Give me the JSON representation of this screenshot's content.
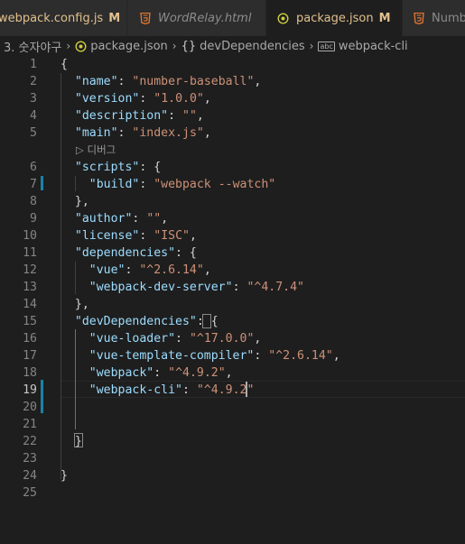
{
  "tabs": [
    {
      "label": "webpack.config.js",
      "status": "M",
      "has_close": true,
      "icon": "none",
      "italic": false
    },
    {
      "label": "WordRelay.html",
      "icon": "html5-icon",
      "italic": true
    },
    {
      "label": "package.json",
      "status": "M",
      "icon": "json-icon",
      "active": true,
      "unsaved_dot": true
    },
    {
      "label": "Numbe",
      "icon": "html5-icon",
      "italic": false
    }
  ],
  "breadcrumb": {
    "folder": "3. 숫자야구",
    "file": "package.json",
    "section": "devDependencies",
    "leaf": "webpack-cli",
    "braces": "{}",
    "abc": "abc"
  },
  "codelens": "디버그",
  "code_lines": [
    {
      "n": "1",
      "tokens": [
        {
          "t": "p",
          "v": "{"
        }
      ]
    },
    {
      "n": "2",
      "tokens": [
        {
          "t": "p",
          "v": "  "
        },
        {
          "t": "k",
          "v": "\"name\""
        },
        {
          "t": "p",
          "v": ": "
        },
        {
          "t": "s",
          "v": "\"number-baseball\""
        },
        {
          "t": "p",
          "v": ","
        }
      ]
    },
    {
      "n": "3",
      "tokens": [
        {
          "t": "p",
          "v": "  "
        },
        {
          "t": "k",
          "v": "\"version\""
        },
        {
          "t": "p",
          "v": ": "
        },
        {
          "t": "s",
          "v": "\"1.0.0\""
        },
        {
          "t": "p",
          "v": ","
        }
      ]
    },
    {
      "n": "4",
      "tokens": [
        {
          "t": "p",
          "v": "  "
        },
        {
          "t": "k",
          "v": "\"description\""
        },
        {
          "t": "p",
          "v": ": "
        },
        {
          "t": "s",
          "v": "\"\""
        },
        {
          "t": "p",
          "v": ","
        }
      ]
    },
    {
      "n": "5",
      "tokens": [
        {
          "t": "p",
          "v": "  "
        },
        {
          "t": "k",
          "v": "\"main\""
        },
        {
          "t": "p",
          "v": ": "
        },
        {
          "t": "s",
          "v": "\"index.js\""
        },
        {
          "t": "p",
          "v": ","
        }
      ]
    },
    {
      "n": "6",
      "tokens": [
        {
          "t": "p",
          "v": "  "
        },
        {
          "t": "k",
          "v": "\"scripts\""
        },
        {
          "t": "p",
          "v": ": {"
        }
      ]
    },
    {
      "n": "7",
      "tokens": [
        {
          "t": "p",
          "v": "    "
        },
        {
          "t": "k",
          "v": "\"build\""
        },
        {
          "t": "p",
          "v": ": "
        },
        {
          "t": "s",
          "v": "\"webpack --watch\""
        }
      ]
    },
    {
      "n": "8",
      "tokens": [
        {
          "t": "p",
          "v": "  },"
        }
      ]
    },
    {
      "n": "9",
      "tokens": [
        {
          "t": "p",
          "v": "  "
        },
        {
          "t": "k",
          "v": "\"author\""
        },
        {
          "t": "p",
          "v": ": "
        },
        {
          "t": "s",
          "v": "\"\""
        },
        {
          "t": "p",
          "v": ","
        }
      ]
    },
    {
      "n": "10",
      "tokens": [
        {
          "t": "p",
          "v": "  "
        },
        {
          "t": "k",
          "v": "\"license\""
        },
        {
          "t": "p",
          "v": ": "
        },
        {
          "t": "s",
          "v": "\"ISC\""
        },
        {
          "t": "p",
          "v": ","
        }
      ]
    },
    {
      "n": "11",
      "tokens": [
        {
          "t": "p",
          "v": "  "
        },
        {
          "t": "k",
          "v": "\"dependencies\""
        },
        {
          "t": "p",
          "v": ": {"
        }
      ]
    },
    {
      "n": "12",
      "tokens": [
        {
          "t": "p",
          "v": "    "
        },
        {
          "t": "k",
          "v": "\"vue\""
        },
        {
          "t": "p",
          "v": ": "
        },
        {
          "t": "s",
          "v": "\"^2.6.14\""
        },
        {
          "t": "p",
          "v": ","
        }
      ]
    },
    {
      "n": "13",
      "tokens": [
        {
          "t": "p",
          "v": "    "
        },
        {
          "t": "k",
          "v": "\"webpack-dev-server\""
        },
        {
          "t": "p",
          "v": ": "
        },
        {
          "t": "s",
          "v": "\"^4.7.4\""
        }
      ]
    },
    {
      "n": "14",
      "tokens": [
        {
          "t": "p",
          "v": "  },"
        }
      ]
    },
    {
      "n": "15",
      "tokens": [
        {
          "t": "p",
          "v": "  "
        },
        {
          "t": "k",
          "v": "\"devDependencies\""
        },
        {
          "t": "p",
          "v": ": {"
        }
      ]
    },
    {
      "n": "16",
      "tokens": [
        {
          "t": "p",
          "v": "    "
        },
        {
          "t": "k",
          "v": "\"vue-loader\""
        },
        {
          "t": "p",
          "v": ": "
        },
        {
          "t": "s",
          "v": "\"^17.0.0\""
        },
        {
          "t": "p",
          "v": ","
        }
      ]
    },
    {
      "n": "17",
      "tokens": [
        {
          "t": "p",
          "v": "    "
        },
        {
          "t": "k",
          "v": "\"vue-template-compiler\""
        },
        {
          "t": "p",
          "v": ": "
        },
        {
          "t": "s",
          "v": "\"^2.6.14\""
        },
        {
          "t": "p",
          "v": ","
        }
      ]
    },
    {
      "n": "18",
      "tokens": [
        {
          "t": "p",
          "v": "    "
        },
        {
          "t": "k",
          "v": "\"webpack\""
        },
        {
          "t": "p",
          "v": ": "
        },
        {
          "t": "s",
          "v": "\"^4.9.2\""
        },
        {
          "t": "p",
          "v": ","
        }
      ]
    },
    {
      "n": "19",
      "tokens": [
        {
          "t": "p",
          "v": "    "
        },
        {
          "t": "k",
          "v": "\"webpack-cli\""
        },
        {
          "t": "p",
          "v": ": "
        },
        {
          "t": "s",
          "v": "\"^4.9.2\""
        }
      ]
    },
    {
      "n": "20",
      "tokens": []
    },
    {
      "n": "21",
      "tokens": []
    },
    {
      "n": "22",
      "tokens": [
        {
          "t": "p",
          "v": "  }"
        }
      ]
    },
    {
      "n": "23",
      "tokens": []
    },
    {
      "n": "24",
      "tokens": [
        {
          "t": "p",
          "v": "}"
        }
      ]
    },
    {
      "n": "25",
      "tokens": []
    }
  ],
  "colors": {
    "key": "#9cdcfe",
    "string": "#ce9178",
    "punctuation": "#d4d4d4",
    "modified_badge": "#e2c08d",
    "gutter_modified": "#1b81a8"
  }
}
